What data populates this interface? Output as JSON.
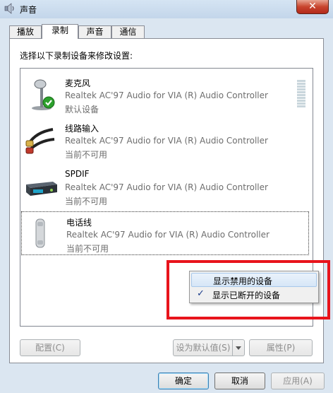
{
  "window": {
    "title": "声音",
    "close_glyph": "✕"
  },
  "tabs": [
    {
      "label": "播放",
      "active": false
    },
    {
      "label": "录制",
      "active": true
    },
    {
      "label": "声音",
      "active": false
    },
    {
      "label": "通信",
      "active": false
    }
  ],
  "instruction": "选择以下录制设备来修改设置:",
  "devices": [
    {
      "name": "麦克风",
      "driver": "Realtek AC'97 Audio for VIA (R) Audio Controller",
      "status": "默认设备",
      "icon": "microphone-icon",
      "default": true
    },
    {
      "name": "线路输入",
      "driver": "Realtek AC'97 Audio for VIA (R) Audio Controller",
      "status": "当前不可用",
      "icon": "line-in-cable-icon",
      "default": false
    },
    {
      "name": "SPDIF",
      "driver": "Realtek AC'97 Audio for VIA (R) Audio Controller",
      "status": "当前不可用",
      "icon": "spdif-device-icon",
      "default": false
    },
    {
      "name": "电话线",
      "driver": "Realtek AC'97 Audio for VIA (R) Audio Controller",
      "status": "当前不可用",
      "icon": "telephone-handset-icon",
      "default": false,
      "selected": true
    }
  ],
  "context_menu": {
    "items": [
      {
        "label": "显示禁用的设备",
        "checked": false,
        "hover": true
      },
      {
        "label": "显示已断开的设备",
        "checked": true,
        "hover": false
      }
    ],
    "check_glyph": "✓"
  },
  "buttons": {
    "configure": "配置(C)",
    "set_default": "设为默认值(S)",
    "properties": "属性(P)",
    "ok": "确定",
    "cancel": "取消",
    "apply": "应用(A)"
  },
  "colors": {
    "highlight_box": "#e8141c",
    "default_check": "#2ca02c"
  }
}
